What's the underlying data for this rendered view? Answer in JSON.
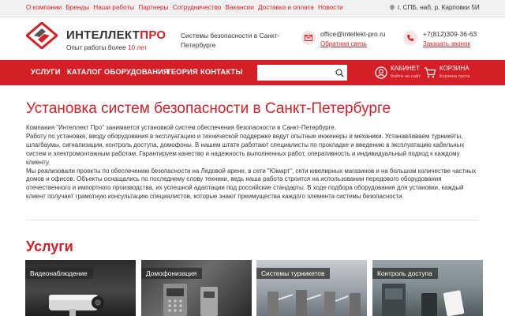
{
  "top_nav": {
    "links": [
      "О компании",
      "Бренды",
      "Наши работы",
      "Партнеры",
      "Сотрудничество",
      "Вакансии",
      "Доставка и оплата",
      "Новости"
    ]
  },
  "address": "г. СПБ, наб. р. Карповки 5И",
  "header": {
    "brand_main": "ИНТЕЛЛЕКТ",
    "brand_accent": "ПРО",
    "experience_prefix": "Опыт работы более ",
    "experience_years": "10 лет",
    "tagline": "Системы безопасности в Санкт-Петербурге",
    "email": "office@intellekt-pro.ru",
    "feedback_link": "Обратная связь",
    "phone": "+7(812)309-36-63",
    "callback_link": "Заказать звонок"
  },
  "main_nav": {
    "items": [
      "Услуги",
      "Каталог оборудования",
      "Теория",
      "Контакты"
    ],
    "search_placeholder": "",
    "cabinet_label": "Кабинет",
    "cabinet_sub": "Войти на сайт",
    "cart_label": "Корзина",
    "cart_sub": "Корзина пуста"
  },
  "content": {
    "title": "Установка систем безопасности в Санкт-Петербурге",
    "paragraphs": [
      "Компания \"Интеллект Про\" занимается установкой систем обеспечения безопасности в Санкт-Петербурге.",
      "Работу по установке, вводу оборудования в эксплуатацию и технической поддержке ведут опытные инженеры и механики. Устанавливаем турникеты, шлагбаумы, сигнализации, контроль доступа, домофоны. В нашем штате работают специалисты по прокладке и введению в эксплуатацию кабельных систем и электромонтажным работам. Гарантируем качество и надежность выполненных работ, оперативность и индивидуальный подход к каждому клиенту.",
      "Мы реализовали проекты по обеспечению безопасности на Ледовой арене, в сети \"Юмарт\", сети ювелирных магазинов и на большом количестве частных домов и офисов. Объекты оснащались по последнему слову техники, ведь наша работа строится на использовании передового оборудования отечественного и импортного производства, их успешной адаптации под российские стандарты. В ходе подбора оборудования для установки, каждый клиент получает грамотную консультацию специалистов, которые знают преимущества каждого элемента системы безопасности."
    ]
  },
  "services": {
    "title": "Услуги",
    "cards": [
      "Видеонаблюдение",
      "Домофонизация",
      "Системы турникетов",
      "Контроль доступа"
    ]
  },
  "colors": {
    "brand_red": "#d41f26",
    "topbar_bg": "#f1f1f1"
  },
  "icons": {
    "email": "envelope-icon",
    "phone": "phone-icon",
    "search": "search-icon",
    "cabinet": "user-icon",
    "cart": "cart-icon",
    "address": "map-pin-icon"
  }
}
